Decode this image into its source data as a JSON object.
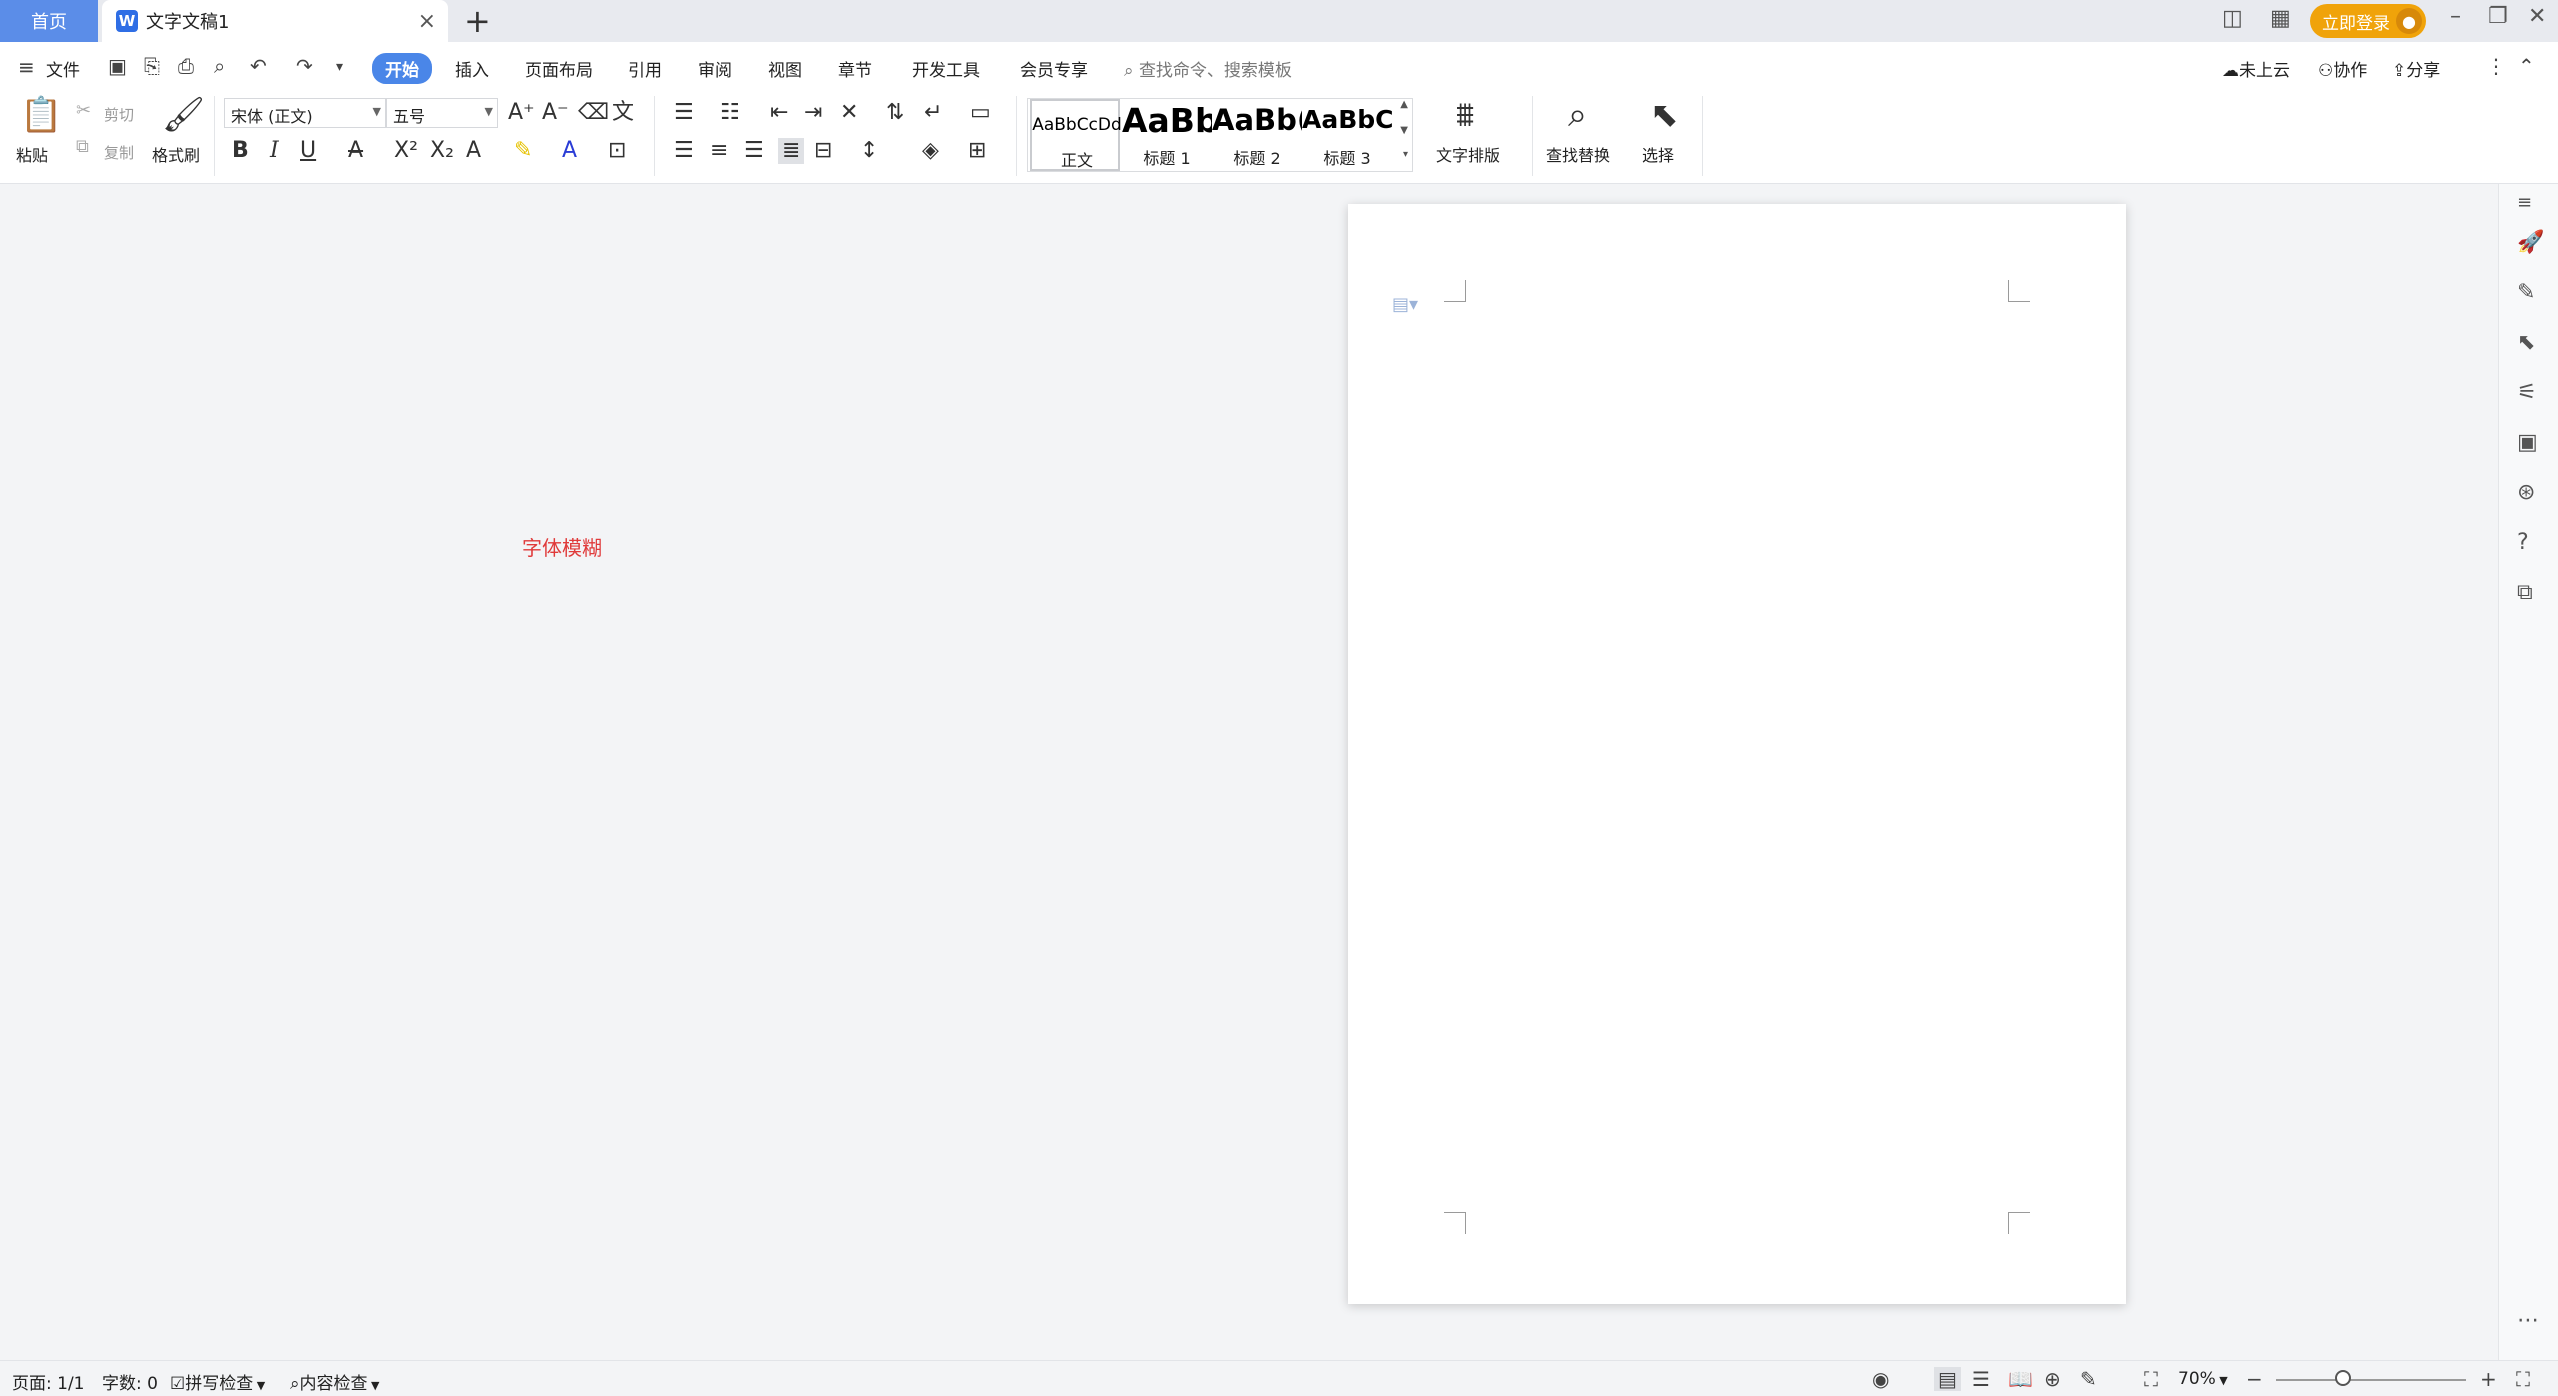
{
  "titlebar": {
    "home_tab": "首页",
    "doc_tab": "文字文稿1",
    "login_label": "立即登录"
  },
  "menu": {
    "file": "文件",
    "tabs": [
      "开始",
      "插入",
      "页面布局",
      "引用",
      "审阅",
      "视图",
      "章节",
      "开发工具",
      "会员专享"
    ],
    "active_tab": "开始",
    "search_placeholder": "查找命令、搜索模板",
    "cloud": "未上云",
    "collab": "协作",
    "share": "分享"
  },
  "ribbon": {
    "paste": "粘贴",
    "cut": "剪切",
    "copy": "复制",
    "format_painter": "格式刷",
    "font_name": "宋体 (正文)",
    "font_size": "五号",
    "styles": [
      {
        "sample": "AaBbCcDd",
        "name": "正文"
      },
      {
        "sample": "AaBb",
        "name": "标题 1"
      },
      {
        "sample": "AaBb(",
        "name": "标题 2"
      },
      {
        "sample": "AaBbC",
        "name": "标题 3"
      }
    ],
    "text_layout": "文字排版",
    "find_replace": "查找替换",
    "select": "选择"
  },
  "workspace": {
    "overlay_note": "字体模糊"
  },
  "statusbar": {
    "page": "页面: 1/1",
    "words": "字数: 0",
    "spell_check": "拼写检查",
    "content_check": "内容检查",
    "zoom": "70%",
    "zoom_fraction": 0.35
  },
  "colors": {
    "accent": "#4a86e8",
    "home_tab": "#5b8de8",
    "login": "#f0a30a",
    "note_red": "#e03a3a"
  }
}
